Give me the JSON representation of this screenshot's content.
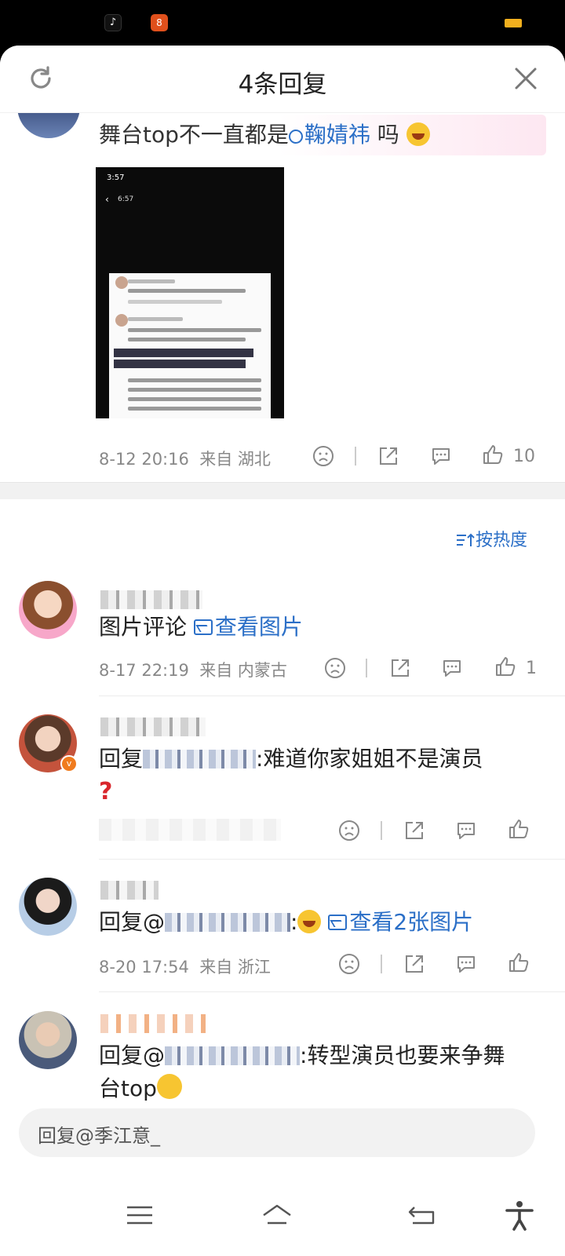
{
  "status_bar": {
    "app1_icon": "tiktok-icon",
    "app2_icon": "app-icon",
    "battery_color": "#f2b01e"
  },
  "sheet": {
    "title": "4条回复",
    "refresh_icon": "refresh-icon",
    "close_icon": "close-icon"
  },
  "parent_comment": {
    "text_before": "舞台top不一直都是",
    "mention": "鞠婧祎",
    "text_after": " 吗",
    "time": "8-12 20:16",
    "location": "来自 湖北",
    "likes": "10",
    "screenshot": {
      "status_time": "3:57",
      "inner_time": "6:57"
    }
  },
  "sort": {
    "label": "按热度"
  },
  "replies": [
    {
      "text_visible": "图片评论",
      "link": "查看图片",
      "time": "8-17 22:19",
      "location": "来自 内蒙古",
      "likes": "1"
    },
    {
      "prefix": "回复",
      "suffix": ":难道你家姐姐不是演员",
      "likes": ""
    },
    {
      "prefix": "回复@",
      "link": "查看2张图片",
      "time": "8-20 17:54",
      "location": "来自 浙江",
      "likes": ""
    },
    {
      "prefix": "回复@",
      "suffix": ":转型演员也要来争舞",
      "suffix2": "台top"
    }
  ],
  "reply_bar": {
    "placeholder": "回复@季江意_"
  },
  "nav": {
    "menu_icon": "menu-icon",
    "home_icon": "home-icon",
    "back_icon": "back-icon",
    "accessibility_icon": "accessibility-icon"
  }
}
